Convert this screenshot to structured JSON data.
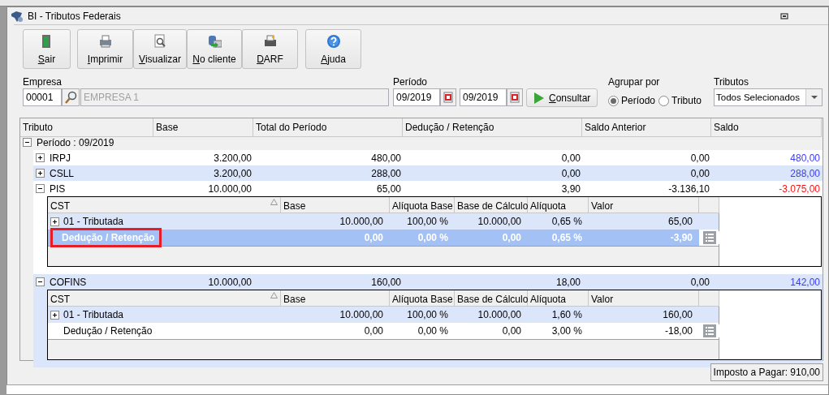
{
  "window": {
    "title": "BI - Tributos Federais"
  },
  "toolbar": [
    {
      "label": "Sair",
      "kind": "exit"
    },
    {
      "label": "Imprimir",
      "kind": "print"
    },
    {
      "label": "Visualizar",
      "kind": "preview"
    },
    {
      "label": "No cliente",
      "kind": "client"
    },
    {
      "label": "DARF",
      "kind": "darf"
    },
    {
      "label": "Ajuda",
      "kind": "help"
    }
  ],
  "filters": {
    "empresa": {
      "label": "Empresa",
      "code": "00001",
      "name": "EMPRESA 1"
    },
    "periodo": {
      "label": "Período",
      "start": "09/2019",
      "end": "09/2019"
    },
    "consultar": "Consultar",
    "agrupar": {
      "label": "Agrupar por",
      "options": [
        {
          "label": "Período",
          "selected": true
        },
        {
          "label": "Tributo",
          "selected": false
        }
      ]
    },
    "tributos": {
      "label": "Tributos",
      "value": "Todos Selecionados"
    }
  },
  "grid": {
    "columns": [
      "Tributo",
      "Base",
      "Total do Período",
      "Dedução / Retenção",
      "Saldo Anterior",
      "Saldo"
    ],
    "groups": [
      {
        "label": "Período : 09/2019",
        "expanded": true,
        "rows": [
          {
            "tributo": "IRPJ",
            "base": "3.200,00",
            "total": "480,00",
            "deducao": "0,00",
            "saldo_anterior": "0,00",
            "saldo": "480,00",
            "color": "#3c3cf0",
            "expanded": false
          },
          {
            "tributo": "CSLL",
            "base": "3.200,00",
            "total": "288,00",
            "deducao": "0,00",
            "saldo_anterior": "0,00",
            "saldo": "288,00",
            "color": "#3c3cf0",
            "expanded": false
          },
          {
            "tributo": "PIS",
            "base": "10.000,00",
            "total": "65,00",
            "deducao": "3,90",
            "saldo_anterior": "-3.136,10",
            "saldo": "-3.075,00",
            "color": "#f01818",
            "expanded": true,
            "detail": {
              "columns": [
                "CST",
                "Base",
                "Alíquota Base",
                "Base de Cálculo",
                "Alíquota",
                "Valor"
              ],
              "rows": [
                {
                  "kind": "group",
                  "cst": "01 - Tributada",
                  "base": "10.000,00",
                  "aliquota_base": "100,00 %",
                  "base_calculo": "10.000,00",
                  "aliquota": "0,65 %",
                  "valor": "65,00",
                  "expanded": false,
                  "selected": false,
                  "highlighted": false
                },
                {
                  "kind": "row",
                  "cst": "Dedução / Retenção",
                  "base": "0,00",
                  "aliquota_base": "0,00 %",
                  "base_calculo": "0,00",
                  "aliquota": "0,65 %",
                  "valor": "-3,90",
                  "selected": true,
                  "highlighted": true
                }
              ]
            }
          },
          {
            "tributo": "COFINS",
            "base": "10.000,00",
            "total": "160,00",
            "deducao": "18,00",
            "saldo_anterior": "0,00",
            "saldo": "142,00",
            "color": "#3c3cf0",
            "expanded": true,
            "detail": {
              "columns": [
                "CST",
                "Base",
                "Alíquota Base",
                "Base de Cálculo",
                "Alíquota",
                "Valor"
              ],
              "rows": [
                {
                  "kind": "group",
                  "cst": "01 - Tributada",
                  "base": "10.000,00",
                  "aliquota_base": "100,00 %",
                  "base_calculo": "10.000,00",
                  "aliquota": "1,60 %",
                  "valor": "160,00",
                  "expanded": false,
                  "selected": false,
                  "highlighted": false
                },
                {
                  "kind": "row",
                  "cst": "Dedução / Retenção",
                  "base": "0,00",
                  "aliquota_base": "0,00 %",
                  "base_calculo": "0,00",
                  "aliquota": "3,00 %",
                  "valor": "-18,00",
                  "selected": false,
                  "highlighted": false
                }
              ]
            }
          }
        ]
      }
    ]
  },
  "footer": {
    "total": "Imposto a Pagar: 910,00"
  }
}
